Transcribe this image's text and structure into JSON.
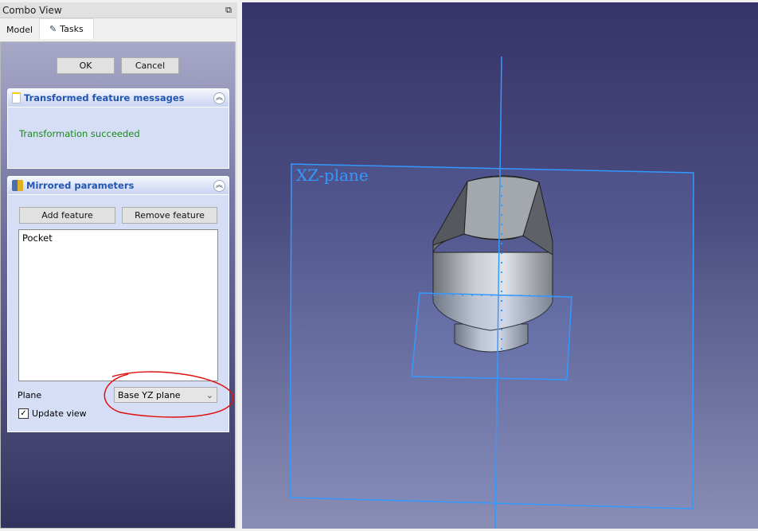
{
  "combo_view": {
    "title": "Combo View",
    "tabs": [
      {
        "label": "Model"
      },
      {
        "label": "Tasks"
      }
    ]
  },
  "task": {
    "ok_label": "OK",
    "cancel_label": "Cancel"
  },
  "messages_panel": {
    "title": "Transformed feature messages",
    "message": "Transformation succeeded",
    "message_color": "#1a8a1a"
  },
  "mirrored_panel": {
    "title": "Mirrored parameters",
    "add_label": "Add feature",
    "remove_label": "Remove feature",
    "features": [
      "Pocket"
    ],
    "plane_label": "Plane",
    "plane_value": "Base YZ plane",
    "update_view_label": "Update view",
    "update_view_checked": true
  },
  "viewport": {
    "plane_label": "XZ-plane",
    "accent": "#3399ff"
  }
}
